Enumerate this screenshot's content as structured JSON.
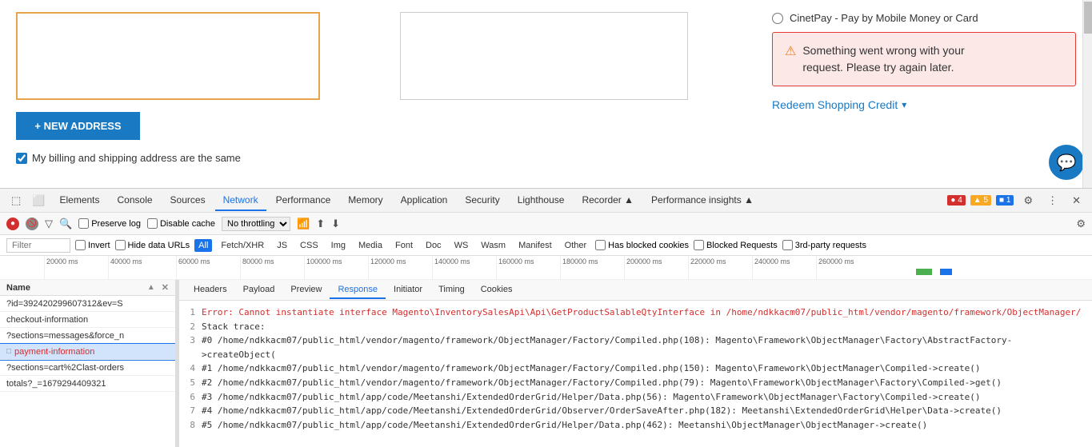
{
  "top": {
    "new_address_btn": "+ NEW ADDRESS",
    "billing_checkbox_label": "My billing and shipping address are the same",
    "payment_option": "CinetPay - Pay by Mobile Money or Card",
    "error_message_line1": "Something went wrong with your",
    "error_message_line2": "request. Please try again later.",
    "redeem_credit": "Redeem Shopping Credit"
  },
  "devtools": {
    "tabs": [
      "Elements",
      "Console",
      "Sources",
      "Network",
      "Performance",
      "Memory",
      "Application",
      "Security",
      "Lighthouse",
      "Recorder ▲",
      "Performance insights ▲"
    ],
    "active_tab": "Network",
    "badges": {
      "errors": "● 4",
      "warnings": "▲ 5",
      "messages": "■ 1"
    },
    "toolbar": {
      "preserve_log": "Preserve log",
      "disable_cache": "Disable cache",
      "throttle": "No throttling"
    },
    "filter": {
      "placeholder": "Filter",
      "invert": "Invert",
      "hide_data_urls": "Hide data URLs",
      "types": [
        "All",
        "Fetch/XHR",
        "JS",
        "CSS",
        "Img",
        "Media",
        "Font",
        "Doc",
        "WS",
        "Wasm",
        "Manifest",
        "Other"
      ],
      "active_type": "All",
      "has_blocked": "Has blocked cookies",
      "blocked_requests": "Blocked Requests",
      "third_party": "3rd-party requests"
    },
    "timeline_ticks": [
      "20000 ms",
      "40000 ms",
      "60000 ms",
      "80000 ms",
      "100000 ms",
      "120000 ms",
      "140000 ms",
      "160000 ms",
      "180000 ms",
      "200000 ms",
      "220000 ms",
      "240000 ms",
      "260000 ms"
    ],
    "network_list": {
      "header": "Name",
      "items": [
        "?id=392420299607312&ev=S",
        "checkout-information",
        "?sections=messages&force_n",
        "payment-information",
        "?sections=cart%2Clast-orders",
        "totals?_=1679294409321"
      ]
    },
    "detail_tabs": [
      "Headers",
      "Payload",
      "Preview",
      "Response",
      "Initiator",
      "Timing",
      "Cookies"
    ],
    "active_detail_tab": "Response",
    "error_lines": [
      {
        "num": "1",
        "text": "Error: Cannot instantiate interface Magento\\InventorySalesApi\\Api\\GetProductSalableQtyInterface in /home/ndkkacm07/public_html/vendor/magento/framework/ObjectManager/",
        "type": "error"
      },
      {
        "num": "2",
        "text": "Stack trace:",
        "type": "normal"
      },
      {
        "num": "3",
        "text": "#0 /home/ndkkacm07/public_html/vendor/magento/framework/ObjectManager/Factory/Compiled.php(108): Magento\\Framework\\ObjectManager\\Factory\\AbstractFactory->createObject(",
        "type": "normal"
      },
      {
        "num": "4",
        "text": "#1 /home/ndkkacm07/public_html/vendor/magento/framework/ObjectManager/Factory/Compiled.php(150): Magento\\Framework\\ObjectManager\\Compiled->create()",
        "type": "normal"
      },
      {
        "num": "5",
        "text": "#2 /home/ndkkacm07/public_html/vendor/magento/framework/ObjectManager/Factory/Compiled.php(79): Magento\\Framework\\ObjectManager\\Factory\\Compiled->get()",
        "type": "normal"
      },
      {
        "num": "6",
        "text": "#3 /home/ndkkacm07/public_html/app/code/Meetanshi/ExtendedOrderGrid/Helper/Data.php(56): Magento\\Framework\\ObjectManager\\Factory\\Compiled->create()",
        "type": "normal"
      },
      {
        "num": "7",
        "text": "#4 /home/ndkkacm07/public_html/app/code/Meetanshi/ExtendedOrderGrid/Observer/OrderSaveAfter.php(182): Meetanshi\\ExtendedOrderGrid\\Helper\\Data->create()",
        "type": "normal"
      },
      {
        "num": "8",
        "text": "#5 /home/ndkkacm07/public_html/app/code/Meetanshi/ExtendedOrderGrid/Helper/Data.php(462): Meetanshi\\ObjectManager\\ObjectManager->create()",
        "type": "normal"
      }
    ]
  }
}
